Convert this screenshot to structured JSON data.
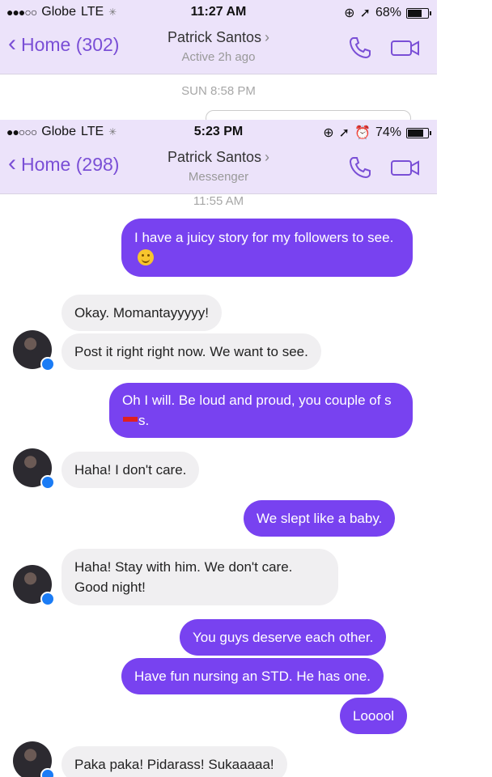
{
  "screens": [
    {
      "status": {
        "carrier": "Globe",
        "network": "LTE",
        "time": "11:27 AM",
        "battery": "68%"
      },
      "nav": {
        "back_label": "Home (302)",
        "contact_name": "Patrick Santos",
        "subtitle": "Active 2h ago"
      },
      "timestamp": "SUN 8:58 PM"
    },
    {
      "status": {
        "carrier": "Globe",
        "network": "LTE",
        "time": "5:23 PM",
        "battery": "74%"
      },
      "nav": {
        "back_label": "Home (298)",
        "contact_name": "Patrick Santos",
        "subtitle": "Messenger"
      },
      "timestamp": "11:55 AM",
      "messages": [
        {
          "dir": "out",
          "text": "I have a juicy story for my followers to see."
        },
        {
          "dir": "in",
          "text": "Okay. Momantayyyyy!"
        },
        {
          "dir": "in",
          "text": "Post it right right now. We want to see."
        },
        {
          "dir": "out",
          "text_a": "Oh I will. Be loud and proud, you couple of s",
          "text_b": "s."
        },
        {
          "dir": "in",
          "text": "Haha! I don't care."
        },
        {
          "dir": "out",
          "text": "We slept like a baby."
        },
        {
          "dir": "in",
          "text": "Haha! Stay with him. We don't care. Good night!"
        },
        {
          "dir": "out",
          "text": "You guys deserve each other."
        },
        {
          "dir": "out",
          "text": "Have fun nursing an STD. He has one."
        },
        {
          "dir": "out",
          "text": "Looool"
        },
        {
          "dir": "in",
          "text": "Paka paka! Pidarass! Sukaaaaa!"
        }
      ]
    }
  ],
  "colors": {
    "accent": "#7842f0",
    "header_bg": "#ece3fa",
    "incoming_bg": "#f0eff1",
    "badge": "#1b7cf5"
  },
  "icons": [
    "back-chevron-icon",
    "phone-icon",
    "video-icon",
    "messenger-badge-icon",
    "smile-emoji-icon"
  ]
}
